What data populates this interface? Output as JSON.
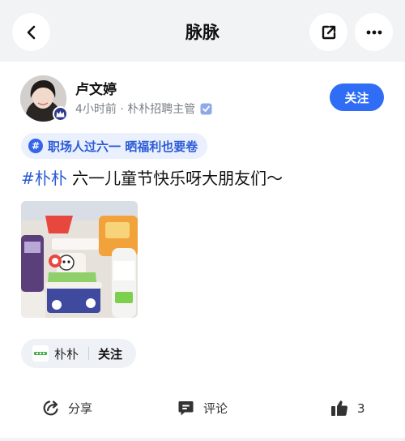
{
  "header": {
    "title": "脉脉",
    "icons": {
      "back": "chevron-left-icon",
      "share": "share-out-icon",
      "more": "more-dots-icon"
    }
  },
  "author": {
    "name": "卢文婷",
    "meta": "4小时前 · 朴朴招聘主管",
    "follow_label": "关注"
  },
  "topic": {
    "label": "职场人过六一  晒福利也要卷"
  },
  "post": {
    "hashtag": "#朴朴",
    "text": " 六一儿童节快乐呀大朋友们～"
  },
  "company": {
    "name": "朴朴",
    "follow_label": "关注"
  },
  "actions": {
    "share_label": "分享",
    "comment_label": "评论",
    "like_count": "3"
  },
  "colors": {
    "accent": "#2f6df6",
    "topic_text": "#2b5bd7",
    "topbar_bg": "#f2f3f5"
  }
}
